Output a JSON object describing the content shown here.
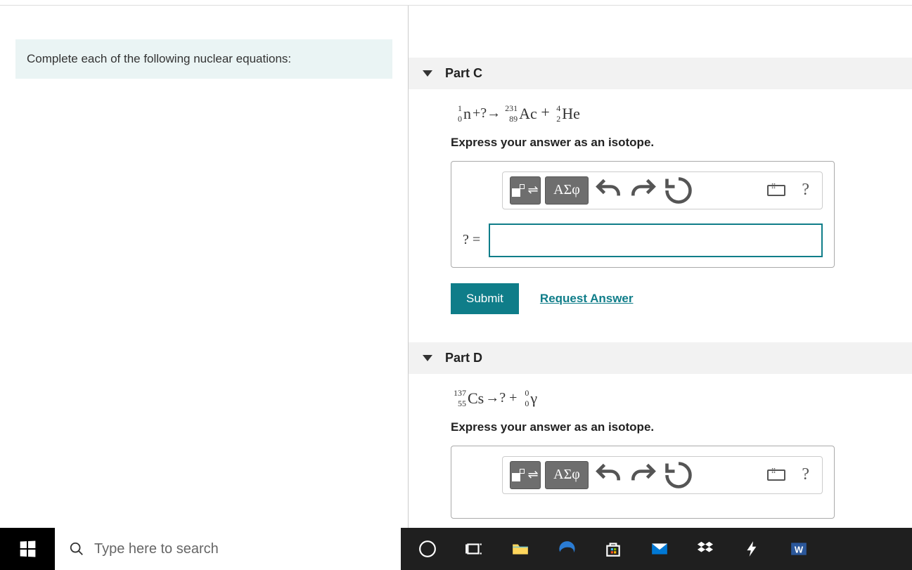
{
  "left": {
    "instruction": "Complete each of the following nuclear equations:"
  },
  "parts": {
    "C": {
      "title": "Part C",
      "equation": {
        "term1": {
          "mass": "1",
          "atomic": "0",
          "symbol": "n"
        },
        "plus1": "+?→",
        "term2": {
          "mass": "231",
          "atomic": "89",
          "symbol": "Ac"
        },
        "plus2": " + ",
        "term3": {
          "mass": "4",
          "atomic": "2",
          "symbol": "He"
        }
      },
      "instruction": "Express your answer as an isotope.",
      "input_label": "? =",
      "input_value": ""
    },
    "D": {
      "title": "Part D",
      "equation": {
        "term1": {
          "mass": "137",
          "atomic": "55",
          "symbol": "Cs"
        },
        "arrow": "→? + ",
        "term2": {
          "mass": "0",
          "atomic": "0",
          "symbol": "γ"
        }
      },
      "instruction": "Express your answer as an isotope."
    }
  },
  "toolbar": {
    "greek_label": "ΑΣφ",
    "help_label": "?"
  },
  "actions": {
    "submit": "Submit",
    "request": "Request Answer"
  },
  "taskbar": {
    "search_placeholder": "Type here to search"
  }
}
